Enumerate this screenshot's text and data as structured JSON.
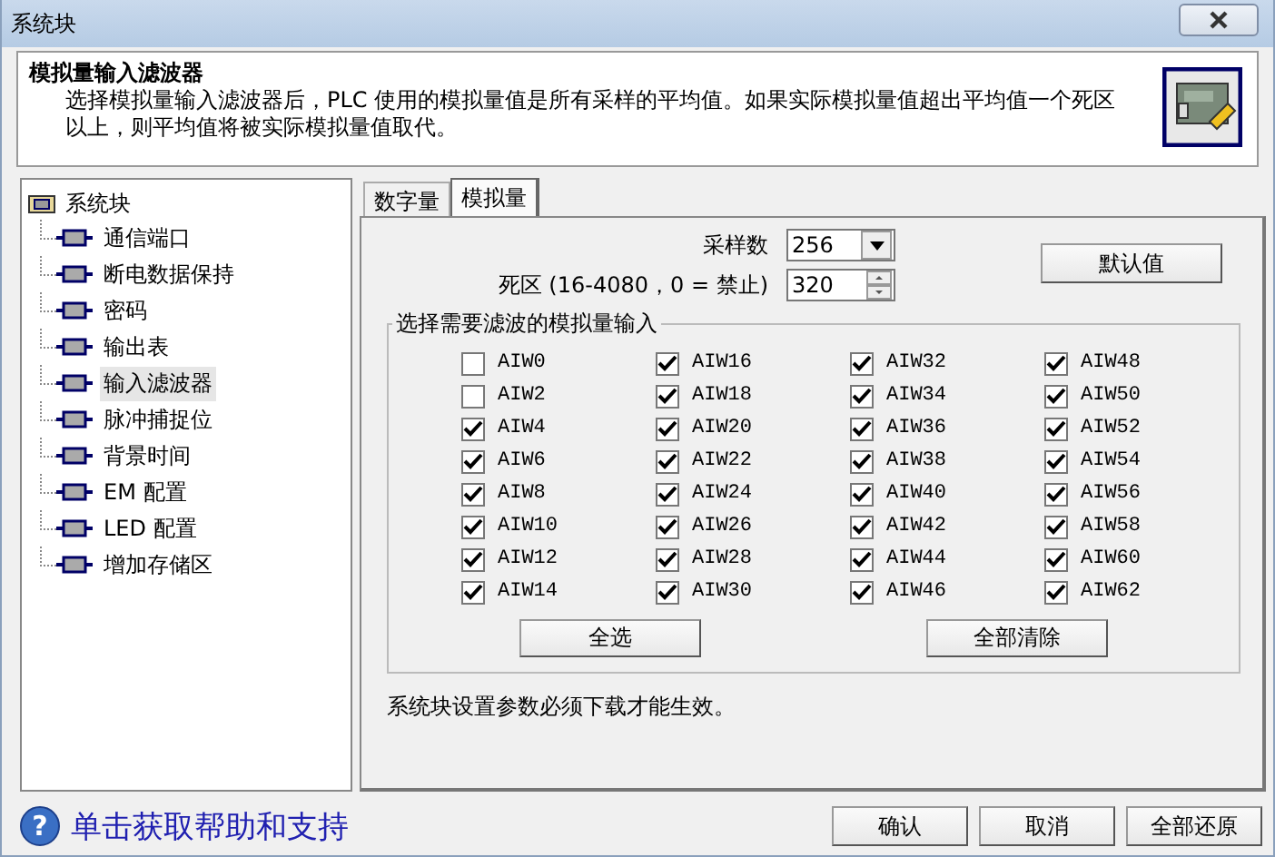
{
  "window": {
    "title": "系统块"
  },
  "header": {
    "title": "模拟量输入滤波器",
    "description": "选择模拟量输入滤波器后，PLC 使用的模拟量值是所有采样的平均值。如果实际模拟量值超出平均值一个死区以上，则平均值将被实际模拟量值取代。"
  },
  "tree": {
    "label": "系统块",
    "children": [
      {
        "label": "通信端口",
        "selected": false
      },
      {
        "label": "断电数据保持",
        "selected": false
      },
      {
        "label": "密码",
        "selected": false
      },
      {
        "label": "输出表",
        "selected": false
      },
      {
        "label": "输入滤波器",
        "selected": true
      },
      {
        "label": "脉冲捕捉位",
        "selected": false
      },
      {
        "label": "背景时间",
        "selected": false
      },
      {
        "label": "EM 配置",
        "selected": false
      },
      {
        "label": "LED 配置",
        "selected": false
      },
      {
        "label": "增加存储区",
        "selected": false
      }
    ]
  },
  "tabs": [
    {
      "label": "数字量",
      "selected": false
    },
    {
      "label": "模拟量",
      "selected": true
    }
  ],
  "sample_count": {
    "label": "采样数",
    "value": "256"
  },
  "deadband": {
    "label": "死区 (16-4080，0 = 禁止)",
    "value": "320"
  },
  "default_button": "默认值",
  "group": {
    "title": "选择需要滤波的模拟量输入",
    "inputs": [
      {
        "label": "AIW0",
        "checked": false
      },
      {
        "label": "AIW2",
        "checked": false
      },
      {
        "label": "AIW4",
        "checked": true
      },
      {
        "label": "AIW6",
        "checked": true
      },
      {
        "label": "AIW8",
        "checked": true
      },
      {
        "label": "AIW10",
        "checked": true
      },
      {
        "label": "AIW12",
        "checked": true
      },
      {
        "label": "AIW14",
        "checked": true
      },
      {
        "label": "AIW16",
        "checked": true
      },
      {
        "label": "AIW18",
        "checked": true
      },
      {
        "label": "AIW20",
        "checked": true
      },
      {
        "label": "AIW22",
        "checked": true
      },
      {
        "label": "AIW24",
        "checked": true
      },
      {
        "label": "AIW26",
        "checked": true
      },
      {
        "label": "AIW28",
        "checked": true
      },
      {
        "label": "AIW30",
        "checked": true
      },
      {
        "label": "AIW32",
        "checked": true
      },
      {
        "label": "AIW34",
        "checked": true
      },
      {
        "label": "AIW36",
        "checked": true
      },
      {
        "label": "AIW38",
        "checked": true
      },
      {
        "label": "AIW40",
        "checked": true
      },
      {
        "label": "AIW42",
        "checked": true
      },
      {
        "label": "AIW44",
        "checked": true
      },
      {
        "label": "AIW46",
        "checked": true
      },
      {
        "label": "AIW48",
        "checked": true
      },
      {
        "label": "AIW50",
        "checked": true
      },
      {
        "label": "AIW52",
        "checked": true
      },
      {
        "label": "AIW54",
        "checked": true
      },
      {
        "label": "AIW56",
        "checked": true
      },
      {
        "label": "AIW58",
        "checked": true
      },
      {
        "label": "AIW60",
        "checked": true
      },
      {
        "label": "AIW62",
        "checked": true
      }
    ],
    "select_all_button": "全选",
    "clear_all_button": "全部清除"
  },
  "note": "系统块设置参数必须下载才能生效。",
  "help": {
    "glyph": "?",
    "text": "单击获取帮助和支持"
  },
  "buttons": [
    "确认",
    "取消",
    "全部还原"
  ]
}
